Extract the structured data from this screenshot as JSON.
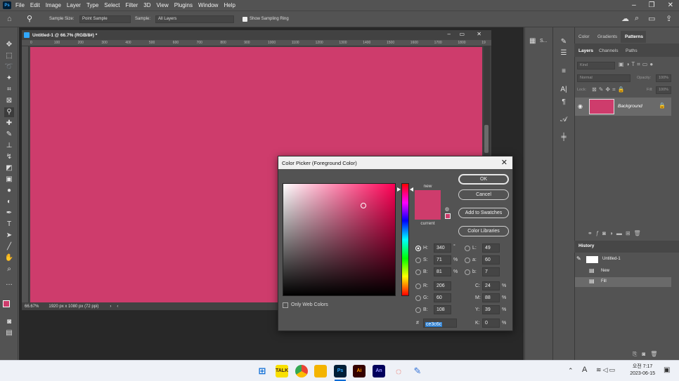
{
  "menubar": {
    "app_icon": "Ps",
    "items": [
      "File",
      "Edit",
      "Image",
      "Layer",
      "Type",
      "Select",
      "Filter",
      "3D",
      "View",
      "Plugins",
      "Window",
      "Help"
    ]
  },
  "options": {
    "sample_size_label": "Sample Size:",
    "sample_size_value": "Point Sample",
    "sample_label": "Sample:",
    "sample_value": "All Layers",
    "sampling_ring_label": "Show Sampling Ring"
  },
  "document": {
    "tab_title": "Untitled-1 @ 66.7% (RGB/8#) *",
    "ruler_ticks": [
      "0",
      "100",
      "200",
      "300",
      "400",
      "500",
      "600",
      "700",
      "800",
      "900",
      "1000",
      "1100",
      "1200",
      "1300",
      "1400",
      "1500",
      "1600",
      "1700",
      "1800",
      "19"
    ],
    "canvas_color": "#ce3c6c",
    "zoom": "66.67%",
    "doc_info": "1920 px x 1080 px (72 ppi)"
  },
  "right_panels": {
    "top_tabs": [
      "Color",
      "Gradients",
      "Patterns"
    ],
    "layer_tabs": [
      "Layers",
      "Channels",
      "Paths"
    ],
    "kind_placeholder": "Kind",
    "blend_mode": "Normal",
    "opacity_label": "Opacity:",
    "opacity_value": "100%",
    "lock_label": "Lock:",
    "fill_label": "Fill:",
    "fill_value": "100%",
    "layer_name": "Background",
    "history_title": "History",
    "history_items": [
      "Untitled-1",
      "New",
      "Fill"
    ]
  },
  "midpanel": {
    "swatches_label": "S..."
  },
  "color_picker": {
    "title": "Color Picker (Foreground Color)",
    "new_label": "new",
    "current_label": "current",
    "new_color": "#ce3c6c",
    "current_color": "#ce3c6c",
    "buttons": {
      "ok": "OK",
      "cancel": "Cancel",
      "add_swatches": "Add to Swatches",
      "libraries": "Color Libraries"
    },
    "only_web_colors": "Only Web Colors",
    "hsb": {
      "h_label": "H:",
      "h_value": "340",
      "h_unit": "°",
      "s_label": "S:",
      "s_value": "71",
      "s_unit": "%",
      "b_label": "B:",
      "b_value": "81",
      "b_unit": "%"
    },
    "rgb": {
      "r_label": "R:",
      "r_value": "206",
      "g_label": "G:",
      "g_value": "60",
      "b_label": "B:",
      "b_value": "108"
    },
    "lab": {
      "l_label": "L:",
      "l_value": "49",
      "a_label": "a:",
      "a_value": "60",
      "b_label": "b:",
      "b_value": "7"
    },
    "cmyk": {
      "c_label": "C:",
      "c_value": "24",
      "c_unit": "%",
      "m_label": "M:",
      "m_value": "88",
      "m_unit": "%",
      "y_label": "Y:",
      "y_value": "39",
      "y_unit": "%",
      "k_label": "K:",
      "k_value": "0",
      "k_unit": "%"
    },
    "hex_label": "#",
    "hex_value": "ce3c6c"
  },
  "taskbar": {
    "apps": [
      "windows-start",
      "kakaotalk",
      "chrome",
      "file-explorer",
      "Ps",
      "Ai",
      "An",
      "office",
      "notes"
    ],
    "ime_label": "A",
    "time": "오전 7:17",
    "date": "2023-06-15"
  }
}
